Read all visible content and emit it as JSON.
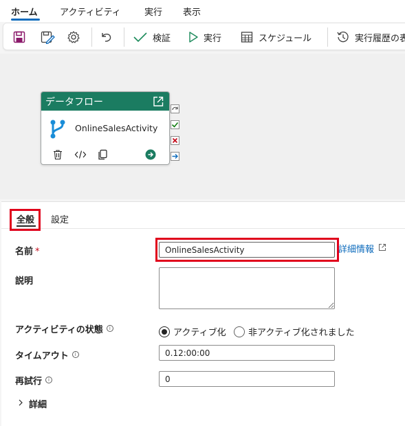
{
  "menu": {
    "tabs": [
      "ホーム",
      "アクティビティ",
      "実行",
      "表示"
    ],
    "active_tab": "ホーム"
  },
  "toolbar": {
    "save_icon": "save-icon",
    "save_as_template_icon": "save-template-icon",
    "settings_icon": "gear-icon",
    "undo_icon": "undo-icon",
    "validate_label": "検証",
    "run_label": "実行",
    "schedule_label": "スケジュール",
    "history_label": "実行履歴の表"
  },
  "canvas": {
    "activity": {
      "type_label": "データフロー",
      "name": "OnlineSalesActivity",
      "header_color": "#1b7c61"
    }
  },
  "panel": {
    "tabs": [
      "全般",
      "設定"
    ],
    "active_tab": "全般",
    "name_label": "名前",
    "required_mark": "*",
    "name_value": "OnlineSalesActivity",
    "more_info_label": "詳細情報",
    "description_label": "説明",
    "description_value": "",
    "activity_state_label": "アクティビティの状態",
    "activity_state_options": [
      "アクティブ化",
      "非アクティブ化されました"
    ],
    "activity_state_selected": "アクティブ化",
    "timeout_label": "タイムアウト",
    "timeout_value": "0.12:00:00",
    "retry_label": "再試行",
    "retry_value": "0",
    "advanced_label": "詳細",
    "info_glyph": "i"
  },
  "colors": {
    "accent": "#0f6cbd",
    "highlight_box": "#e0001b",
    "save_icon": "#8b1a6b"
  }
}
